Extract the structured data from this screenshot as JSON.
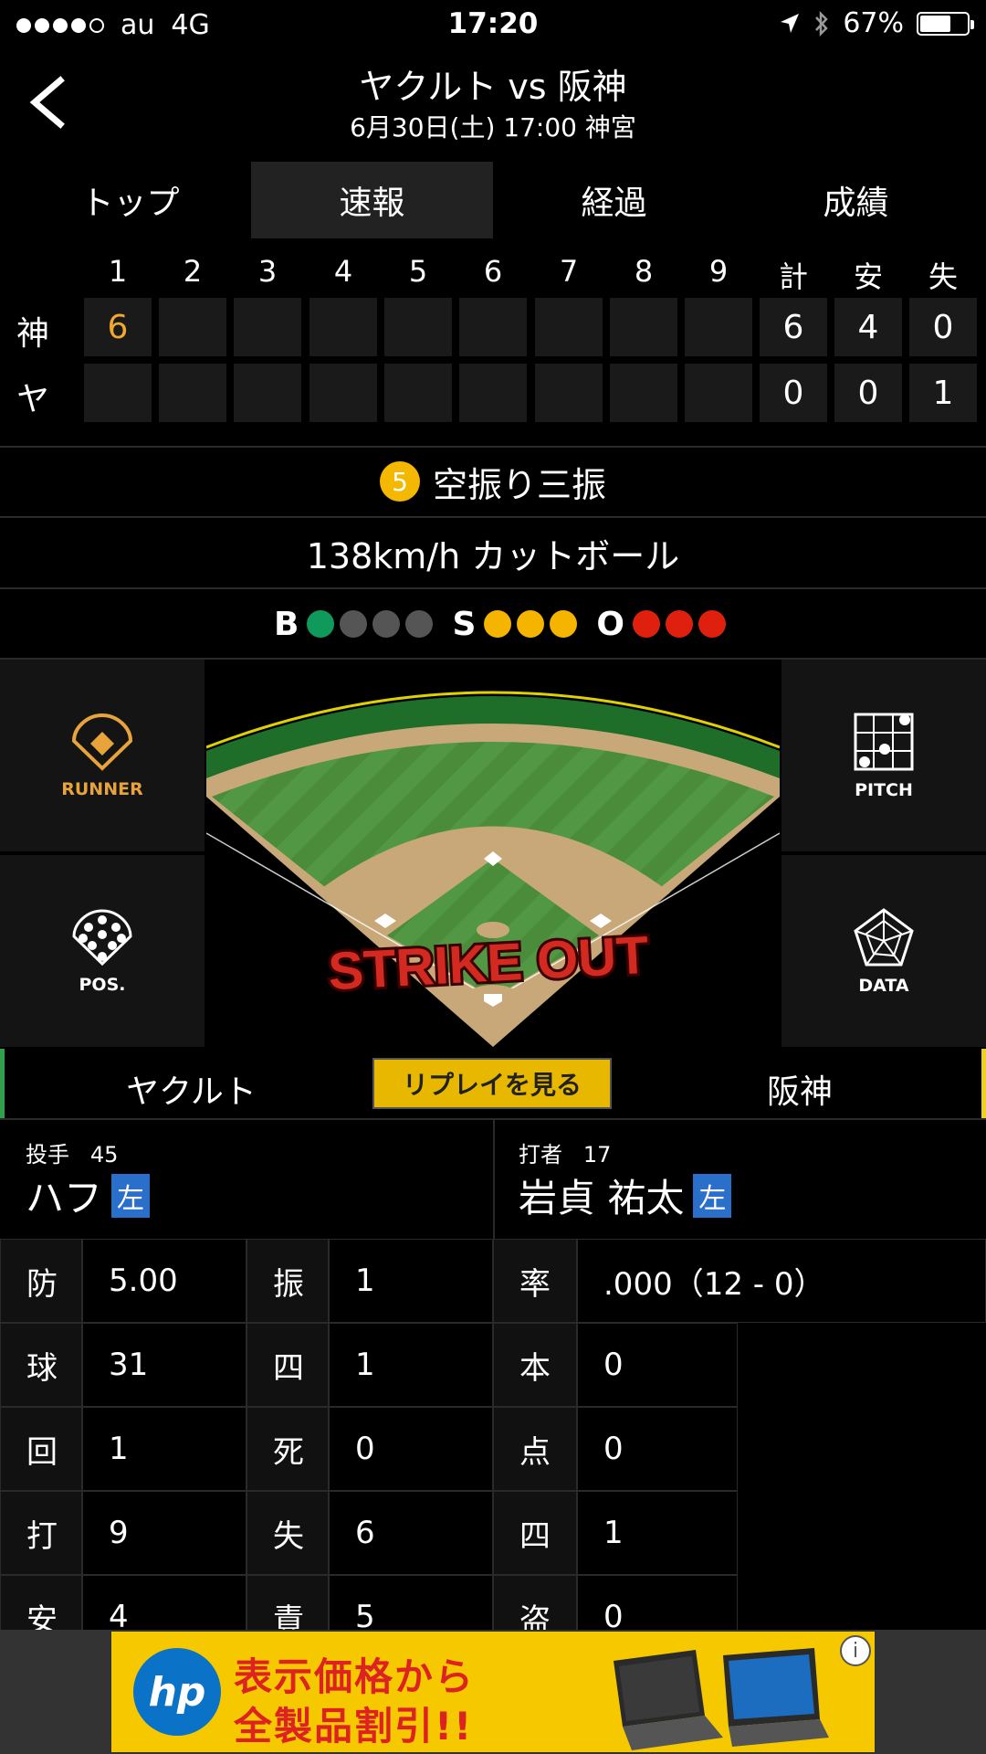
{
  "status": {
    "carrier": "au",
    "network": "4G",
    "time": "17:20",
    "battery": "67%"
  },
  "header": {
    "title": "ヤクルト vs 阪神",
    "subtitle": "6月30日(土) 17:00 神宮"
  },
  "tabs": [
    {
      "label": "トップ"
    },
    {
      "label": "速報"
    },
    {
      "label": "経過"
    },
    {
      "label": "成績"
    }
  ],
  "scoreboard": {
    "innings": [
      "1",
      "2",
      "3",
      "4",
      "5",
      "6",
      "7",
      "8",
      "9"
    ],
    "totals_headers": [
      "計",
      "安",
      "失"
    ],
    "rows": [
      {
        "team": "神",
        "innings": [
          "6",
          "",
          "",
          "",
          "",
          "",
          "",
          "",
          ""
        ],
        "totals": [
          "6",
          "4",
          "0"
        ]
      },
      {
        "team": "ヤ",
        "innings": [
          "",
          "",
          "",
          "",
          "",
          "",
          "",
          "",
          ""
        ],
        "totals": [
          "0",
          "0",
          "1"
        ]
      }
    ]
  },
  "play": {
    "number": "5",
    "result": "空振り三振",
    "pitch": "138km/h カットボール"
  },
  "count": {
    "ball_label": "B",
    "strike_label": "S",
    "out_label": "O",
    "balls": 1,
    "strikes": 3,
    "outs": 3,
    "colors": {
      "ball": "#0f9a5c",
      "strike": "#f5b400",
      "out": "#e0200e",
      "off": "#555555"
    }
  },
  "side_buttons": {
    "runner": "RUNNER",
    "pitch": "PITCH",
    "pos": "POS.",
    "data": "DATA"
  },
  "field": {
    "banner": "STRIKE OUT"
  },
  "teams": {
    "home": "ヤクルト",
    "away": "阪神",
    "replay": "リプレイを見る"
  },
  "pitcher": {
    "role": "投手",
    "number": "45",
    "name": "ハフ",
    "hand": "左"
  },
  "batter": {
    "role": "打者",
    "number": "17",
    "name": "岩貞 祐太",
    "hand": "左"
  },
  "pitcher_stats": [
    {
      "label": "防",
      "value": "5.00"
    },
    {
      "label": "球",
      "value": "31"
    },
    {
      "label": "回",
      "value": "1"
    },
    {
      "label": "打",
      "value": "9"
    },
    {
      "label": "安",
      "value": "4"
    }
  ],
  "pitcher_stats2": [
    {
      "label": "振",
      "value": "1"
    },
    {
      "label": "四",
      "value": "1"
    },
    {
      "label": "死",
      "value": "0"
    },
    {
      "label": "失",
      "value": "6"
    },
    {
      "label": "責",
      "value": "5"
    }
  ],
  "batter_stats": [
    {
      "label": "率",
      "value": ".000（12 - 0）"
    },
    {
      "label": "本",
      "value": "0"
    },
    {
      "label": "点",
      "value": "0"
    },
    {
      "label": "四",
      "value": "1"
    },
    {
      "label": "盗",
      "value": "0"
    }
  ],
  "ad": {
    "logo": "hp",
    "line1": "表示価格から",
    "line2": "全製品割引!!"
  }
}
